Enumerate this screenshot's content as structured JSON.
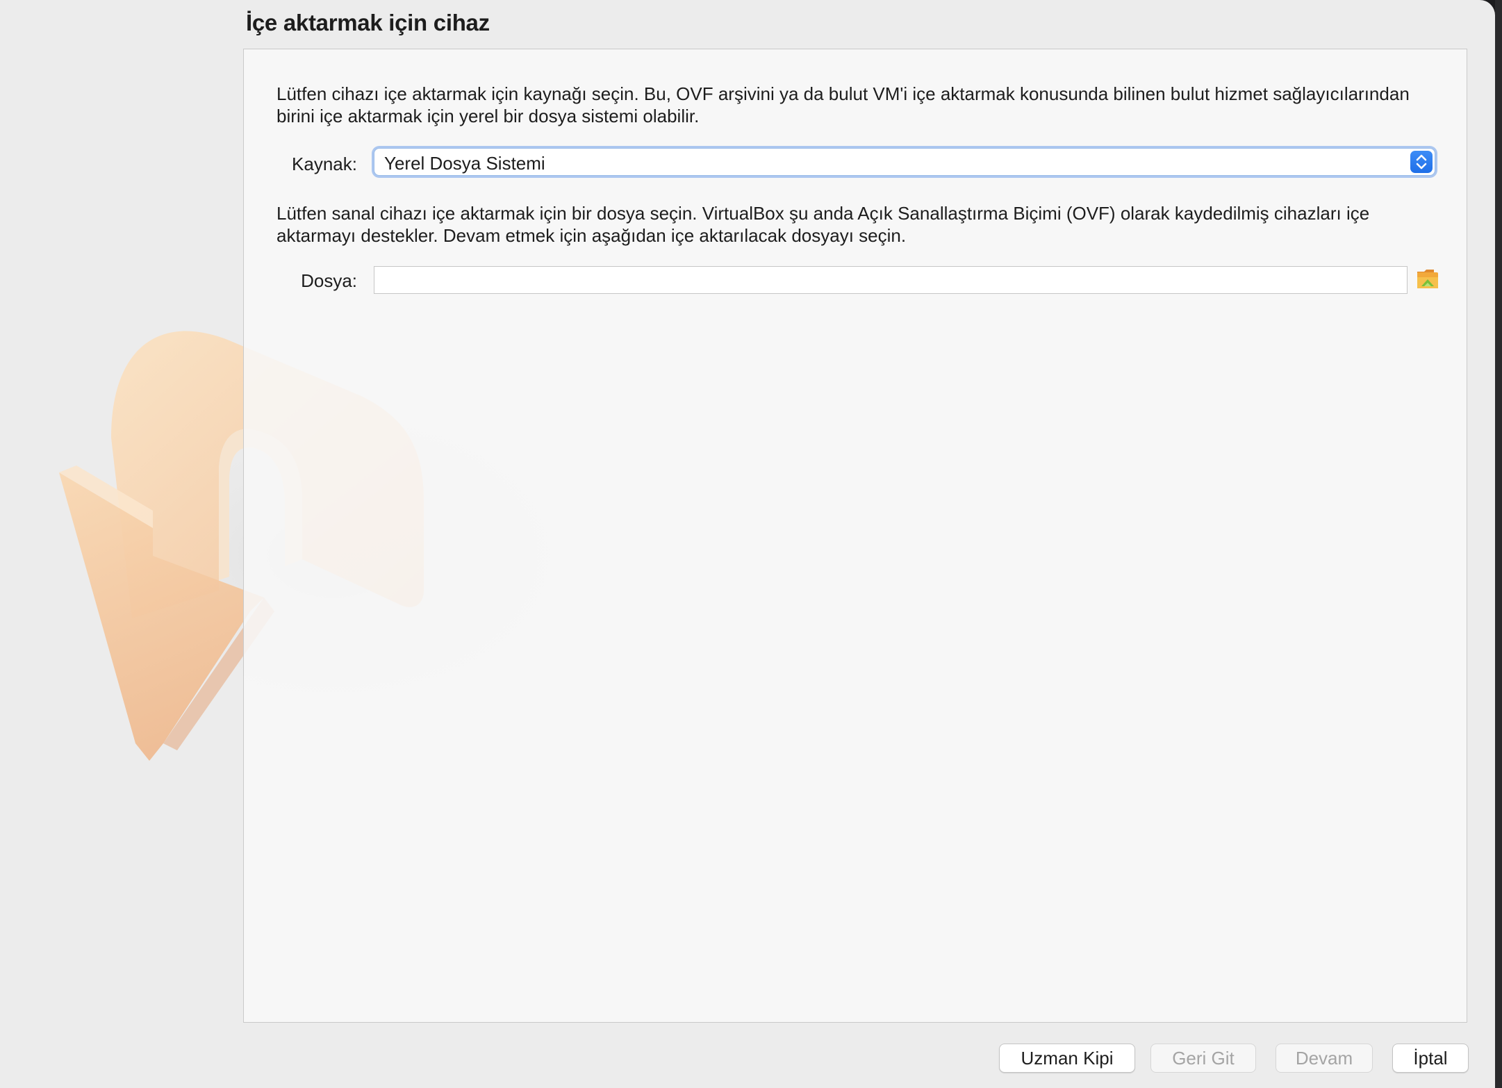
{
  "wizard": {
    "title": "İçe aktarmak için cihaz",
    "source_description": "Lütfen cihazı içe aktarmak için kaynağı seçin. Bu, OVF arşivini ya da bulut VM'i içe aktarmak konusunda bilinen bulut hizmet sağlayıcılarından birini içe aktarmak için yerel bir dosya sistemi olabilir.",
    "source_label": "Kaynak:",
    "source_value": "Yerel Dosya Sistemi",
    "file_description": "Lütfen sanal cihazı içe aktarmak için bir dosya seçin. VirtualBox şu anda Açık Sanallaştırma Biçimi (OVF) olarak kaydedilmiş cihazları içe aktarmayı destekler. Devam etmek için aşağıdan içe aktarılacak dosyayı seçin.",
    "file_label": "Dosya:",
    "file_value": "",
    "folder_icon": "folder-open-icon",
    "watermark_icon": "import-arrow-icon"
  },
  "buttons": {
    "expert_mode": "Uzman Kipi",
    "back": "Geri Git",
    "next": "Devam",
    "cancel": "İptal"
  },
  "colors": {
    "accent": "#1f6fe8",
    "window_bg": "#ececec",
    "panel_bg": "#f8f8f8",
    "watermark": "#f6c79a"
  }
}
